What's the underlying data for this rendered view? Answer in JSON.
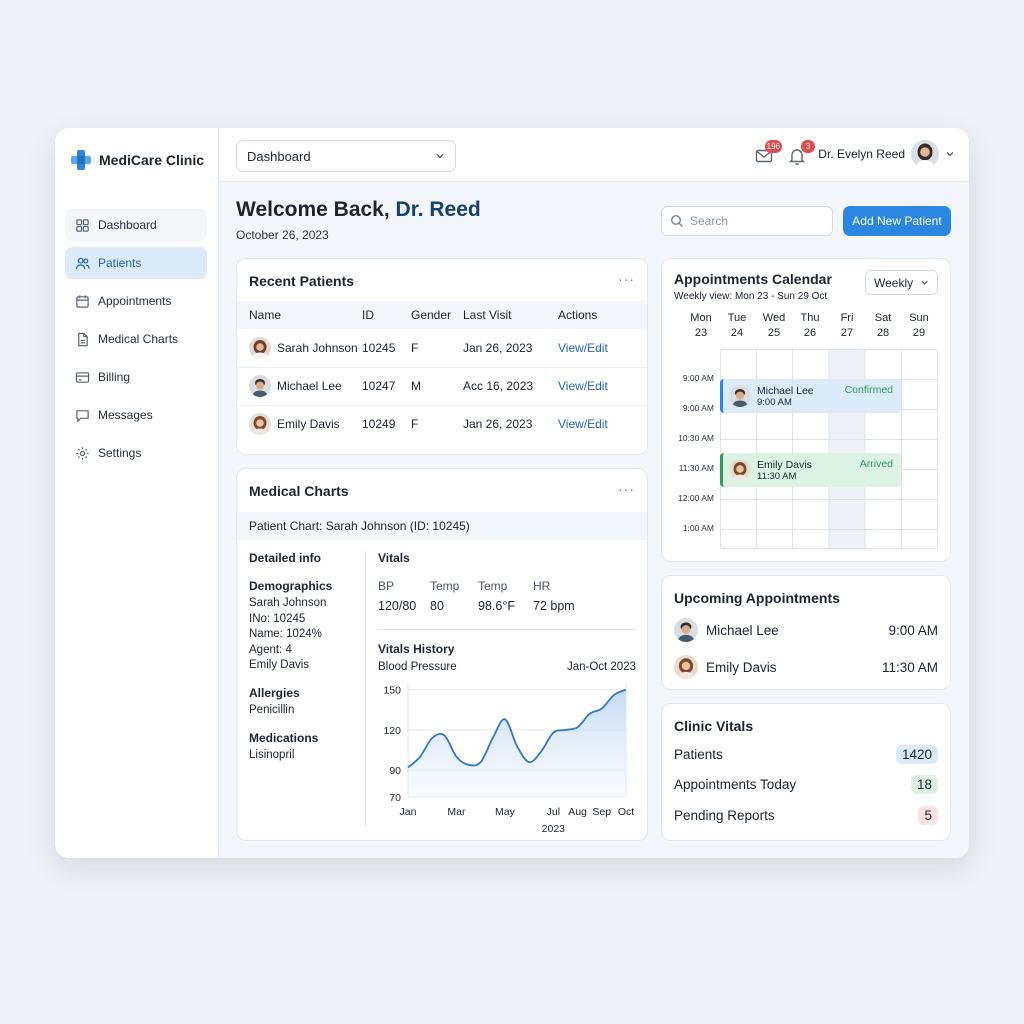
{
  "app": {
    "name": "MediCare Clinic"
  },
  "sidebar": {
    "items": [
      {
        "label": "Dashboard"
      },
      {
        "label": "Patients"
      },
      {
        "label": "Appointments"
      },
      {
        "label": "Medical Charts"
      },
      {
        "label": "Billing"
      },
      {
        "label": "Messages"
      },
      {
        "label": "Settings"
      }
    ]
  },
  "topbar": {
    "view_select": "Dashboard",
    "mail_badge": "196",
    "bell_badge": "3",
    "user_name": "Dr. Evelyn Reed"
  },
  "header": {
    "welcome_prefix": "Welcome Back, ",
    "welcome_name": "Dr. Reed",
    "date": "October 26, 2023",
    "search_placeholder": "Search",
    "add_button": "Add New Patient"
  },
  "recent_patients": {
    "title": "Recent Patients",
    "more": "···",
    "columns": [
      "Name",
      "ID",
      "Gender",
      "Last Visit",
      "Actions"
    ],
    "rows": [
      {
        "name": "Sarah Johnson",
        "id": "10245",
        "gender": "F",
        "last_visit": "Jan 26, 2023",
        "action": "View/Edit"
      },
      {
        "name": "Michael Lee",
        "id": "10247",
        "gender": "M",
        "last_visit": "Acc 16, 2023",
        "action": "View/Edit"
      },
      {
        "name": "Emily Davis",
        "id": "10249",
        "gender": "F",
        "last_visit": "Jan 26, 2023",
        "action": "View/Edit"
      }
    ]
  },
  "medical_charts": {
    "title": "Medical Charts",
    "more": "···",
    "patient_bar": "Patient Chart: Sarah Johnson (ID: 10245)",
    "detailed_info": "Detailed info",
    "demographics_title": "Demographics",
    "demographics": [
      "Sarah Johnson",
      "INo: 10245",
      "Name: 1024%",
      "Agent: 4",
      "Emily Davis"
    ],
    "allergies_title": "Allergies",
    "allergies": "Penicillin",
    "medications_title": "Medications",
    "medications": "Lisinopril",
    "vitals_title": "Vitals",
    "vitals_headers": [
      "BP",
      "Temp",
      "Temp",
      "HR"
    ],
    "vitals_values": [
      "120/80",
      "80",
      "98.6°F",
      "72 bpm"
    ],
    "history_title": "Vitals History",
    "history_subtitle": "Blood Pressure",
    "history_range": "Jan-Oct 2023"
  },
  "chart_data": {
    "type": "area",
    "title": "Blood Pressure",
    "xlabel": "2023",
    "ylabel": "",
    "categories": [
      "Jan",
      "Mar",
      "May",
      "Jul",
      "Aug",
      "Sep",
      "Oct"
    ],
    "x": [
      1,
      1.5,
      2,
      2.5,
      3,
      3.5,
      4,
      4.5,
      5,
      5.5,
      6,
      6.5,
      7,
      7.5,
      8,
      8.5,
      9,
      9.5,
      10
    ],
    "values": [
      92,
      100,
      114,
      116,
      100,
      94,
      96,
      114,
      128,
      108,
      96,
      104,
      118,
      120,
      122,
      132,
      136,
      146,
      150
    ],
    "yticks": [
      70,
      90,
      120,
      150
    ],
    "xtick_positions": [
      1,
      3,
      5,
      7,
      8,
      9,
      10
    ],
    "ylim": [
      70,
      155
    ],
    "xlim": [
      1,
      10
    ]
  },
  "calendar": {
    "title": "Appointments Calendar",
    "subtitle": "Weekly view: Mon 23 - Sun 29 Oct",
    "view": "Weekly",
    "days": [
      {
        "dow": "Mon",
        "num": "23"
      },
      {
        "dow": "Tue",
        "num": "24"
      },
      {
        "dow": "Wed",
        "num": "25"
      },
      {
        "dow": "Thu",
        "num": "26"
      },
      {
        "dow": "Fri",
        "num": "27"
      },
      {
        "dow": "Sat",
        "num": "28"
      },
      {
        "dow": "Sun",
        "num": "29"
      }
    ],
    "times": [
      "9:00 AM",
      "9:00 AM",
      "10:30 AM",
      "11:30 AM",
      "12:00 AM",
      "1:00 AM"
    ],
    "events": [
      {
        "name": "Michael Lee",
        "time": "9:00 AM",
        "status": "Confirmed",
        "color": "#2b86e2"
      },
      {
        "name": "Emily Davis",
        "time": "11:30 AM",
        "status": "Arrived",
        "color": "#2e9a5e"
      }
    ]
  },
  "upcoming": {
    "title": "Upcoming Appointments",
    "items": [
      {
        "name": "Michael Lee",
        "time": "9:00 AM"
      },
      {
        "name": "Emily Davis",
        "time": "11:30 AM"
      }
    ]
  },
  "clinic_vitals": {
    "title": "Clinic Vitals",
    "items": [
      {
        "label": "Patients",
        "value": "1420",
        "color": "#dcebfa"
      },
      {
        "label": "Appointments Today",
        "value": "18",
        "color": "#dcf3e4"
      },
      {
        "label": "Pending Reports",
        "value": "5",
        "color": "#fbe1e1"
      }
    ]
  },
  "colors": {
    "accent": "#2b86e2",
    "brand": "#2b86e2",
    "active_nav_bg": "#dcebfa"
  }
}
